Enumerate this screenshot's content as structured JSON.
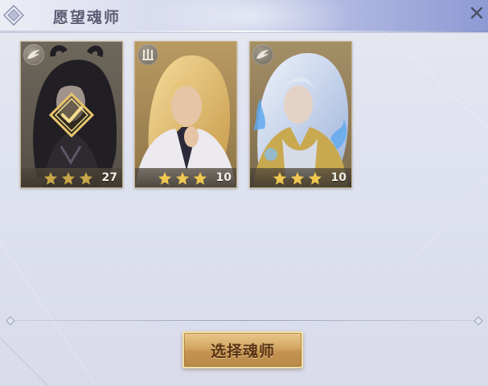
{
  "dialog": {
    "title": "愿望魂师",
    "close_icon": "close-icon"
  },
  "cards": [
    {
      "name_hidden": "",
      "level": "27",
      "stars": 3,
      "type_icon": "wing-icon",
      "selected": true,
      "theme": "dark"
    },
    {
      "name_hidden": "",
      "level": "10",
      "stars": 3,
      "type_icon": "tower-icon",
      "selected": false,
      "theme": "gold"
    },
    {
      "name_hidden": "",
      "level": "10",
      "stars": 3,
      "type_icon": "wing-icon",
      "selected": false,
      "theme": "ice"
    }
  ],
  "footer": {
    "select_button_label": "选择魂师"
  },
  "colors": {
    "star": "#f0c850",
    "button_gold": "#d2a663",
    "header_blue": "#8d9ad4"
  }
}
